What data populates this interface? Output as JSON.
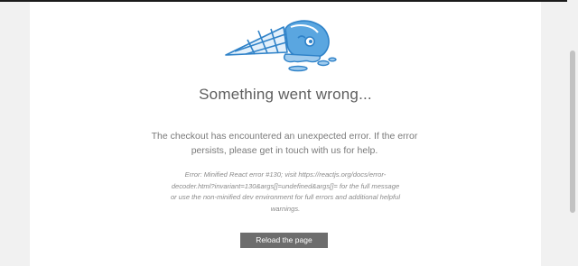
{
  "page": {
    "title": "Something went wrong...",
    "message": "The checkout has encountered an unexpected error. If the error persists, please get in touch with us for help.",
    "error_detail": "Error: Minified React error #130; visit https://reactjs.org/docs/error-decoder.html?invariant=130&args[]=undefined&args[]= for the full message or use the non-minified dev environment for full errors and additional helpful warnings.",
    "reload_label": "Reload the page",
    "illustration_icon": "dropped-ice-cream-icon"
  },
  "colors": {
    "accent": "#2f82c8",
    "button": "#6d6d6d",
    "title": "#5e5e5e",
    "text": "#7a7a7a"
  }
}
